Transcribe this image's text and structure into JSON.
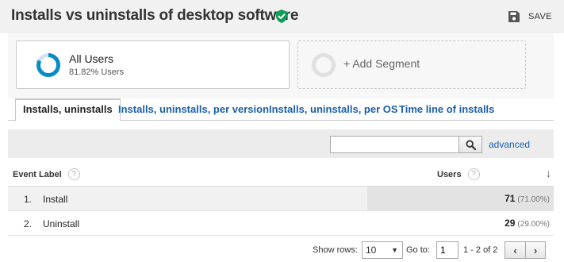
{
  "header": {
    "title": "Installs vs uninstalls of desktop software",
    "save_label": "SAVE",
    "verified_color": "#0f9d58"
  },
  "segments": {
    "active": {
      "name": "All Users",
      "percent_text": "81.82% Users",
      "percent_value": 0.8182,
      "color": "#058dc7"
    },
    "add_label": "+ Add Segment"
  },
  "tabs": [
    {
      "label": "Installs, uninstalls",
      "active": true
    },
    {
      "label": "Installs, uninstalls, per version",
      "active": false
    },
    {
      "label": "Installs, uninstalls, per OS",
      "active": false
    },
    {
      "label": "Time line of installs",
      "active": false
    }
  ],
  "search": {
    "placeholder": "",
    "value": "",
    "advanced_label": "advanced"
  },
  "table": {
    "columns": {
      "event_label": "Event Label",
      "users": "Users",
      "help_glyph": "?"
    },
    "rows": [
      {
        "index": "1.",
        "label": "Install",
        "users": "71",
        "percent": "(71.00%)"
      },
      {
        "index": "2.",
        "label": "Uninstall",
        "users": "29",
        "percent": "(29.00%)"
      }
    ]
  },
  "pagination": {
    "show_rows_label": "Show rows:",
    "rows_value": "10",
    "goto_label": "Go to:",
    "goto_value": "1",
    "range": "1 - 2 of 2"
  }
}
